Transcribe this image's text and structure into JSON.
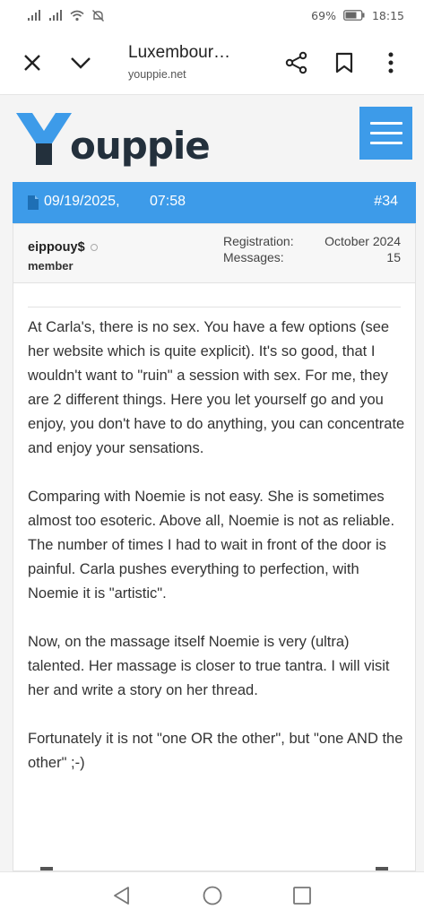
{
  "status_bar": {
    "battery": "69%",
    "time": "18:15",
    "icons": [
      "signal-icon",
      "signal-icon",
      "wifi-icon",
      "mute-icon",
      "battery-icon"
    ]
  },
  "browser": {
    "title": "Luxembour…",
    "url": "youppie.net",
    "icons": [
      "close-icon",
      "chevron-down-icon",
      "share-icon",
      "bookmark-icon",
      "more-icon"
    ]
  },
  "site": {
    "logo_text": "ouppie",
    "brand_color": "#3d9be9",
    "icons": [
      "logo-y-icon",
      "hamburger-menu-icon"
    ]
  },
  "post": {
    "date": "09/19/2025,",
    "time": "07:58",
    "number": "#34",
    "user": {
      "name": "eippouy$",
      "role": "member"
    },
    "stats": [
      {
        "label": "Registration:",
        "value": "October 2024"
      },
      {
        "label": "Messages:",
        "value": "15"
      }
    ],
    "paragraphs": [
      "At Carla's, there is no sex. You have a few options (see her website which is quite explicit). It's so good, that I wouldn't want to \"ruin\" a session with sex. For me, they are 2 different things. Here you let yourself go and you enjoy, you don't have to do anything, you can concentrate and enjoy your sensations.",
      "Comparing with Noemie is not easy. She is sometimes almost too esoteric. Above all, Noemie is not as reliable. The number of times I had to wait in front of the door is painful. Carla pushes everything to perfection, with Noemie it is \"artistic\".",
      "Now, on the massage itself Noemie is very (ultra) talented. Her massage is closer to true tantra. I will visit her and write a story on her thread.",
      "Fortunately it is not \"one OR the other\", but \"one AND the other\" ;-)"
    ]
  },
  "nav": {
    "icons": [
      "back-icon",
      "home-icon",
      "recent-apps-icon"
    ]
  }
}
